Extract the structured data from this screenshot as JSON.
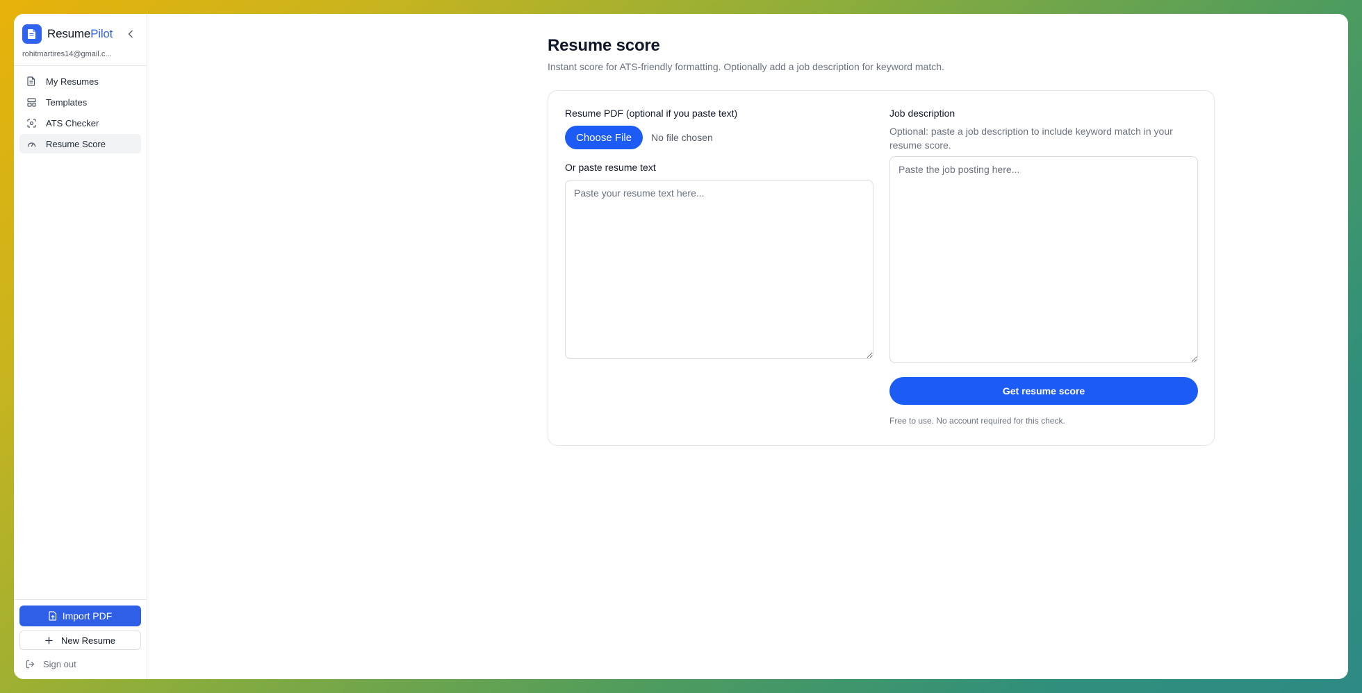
{
  "colors": {
    "accent": "#1d5cf4",
    "brand": "#2f63f0",
    "active_nav_bg": "#f2f3f5"
  },
  "sidebar": {
    "brand_name_part1": "Resume",
    "brand_name_part2": "Pilot",
    "logo_icon": "document-icon",
    "collapse_icon": "chevron-left-icon",
    "user_email": "rohitmartires14@gmail.c...",
    "items": [
      {
        "label": "My Resumes",
        "icon": "file-text-icon",
        "active": false
      },
      {
        "label": "Templates",
        "icon": "layout-template-icon",
        "active": false
      },
      {
        "label": "ATS Checker",
        "icon": "scan-face-icon",
        "active": false
      },
      {
        "label": "Resume Score",
        "icon": "gauge-icon",
        "active": true
      }
    ],
    "import_label": "Import PDF",
    "new_resume_label": "New Resume",
    "signout_label": "Sign out"
  },
  "main": {
    "title": "Resume score",
    "subtitle": "Instant score for ATS-friendly formatting. Optionally add a job description for keyword match.",
    "resume_pdf_label": "Resume PDF (optional if you paste text)",
    "choose_file_label": "Choose File",
    "file_status": "No file chosen",
    "paste_label": "Or paste resume text",
    "resume_placeholder": "Paste your resume text here...",
    "resume_value": "",
    "job_label": "Job description",
    "job_hint": "Optional: paste a job description to include keyword match in your resume score.",
    "job_placeholder": "Paste the job posting here...",
    "job_value": "",
    "submit_label": "Get resume score",
    "note": "Free to use. No account required for this check."
  }
}
